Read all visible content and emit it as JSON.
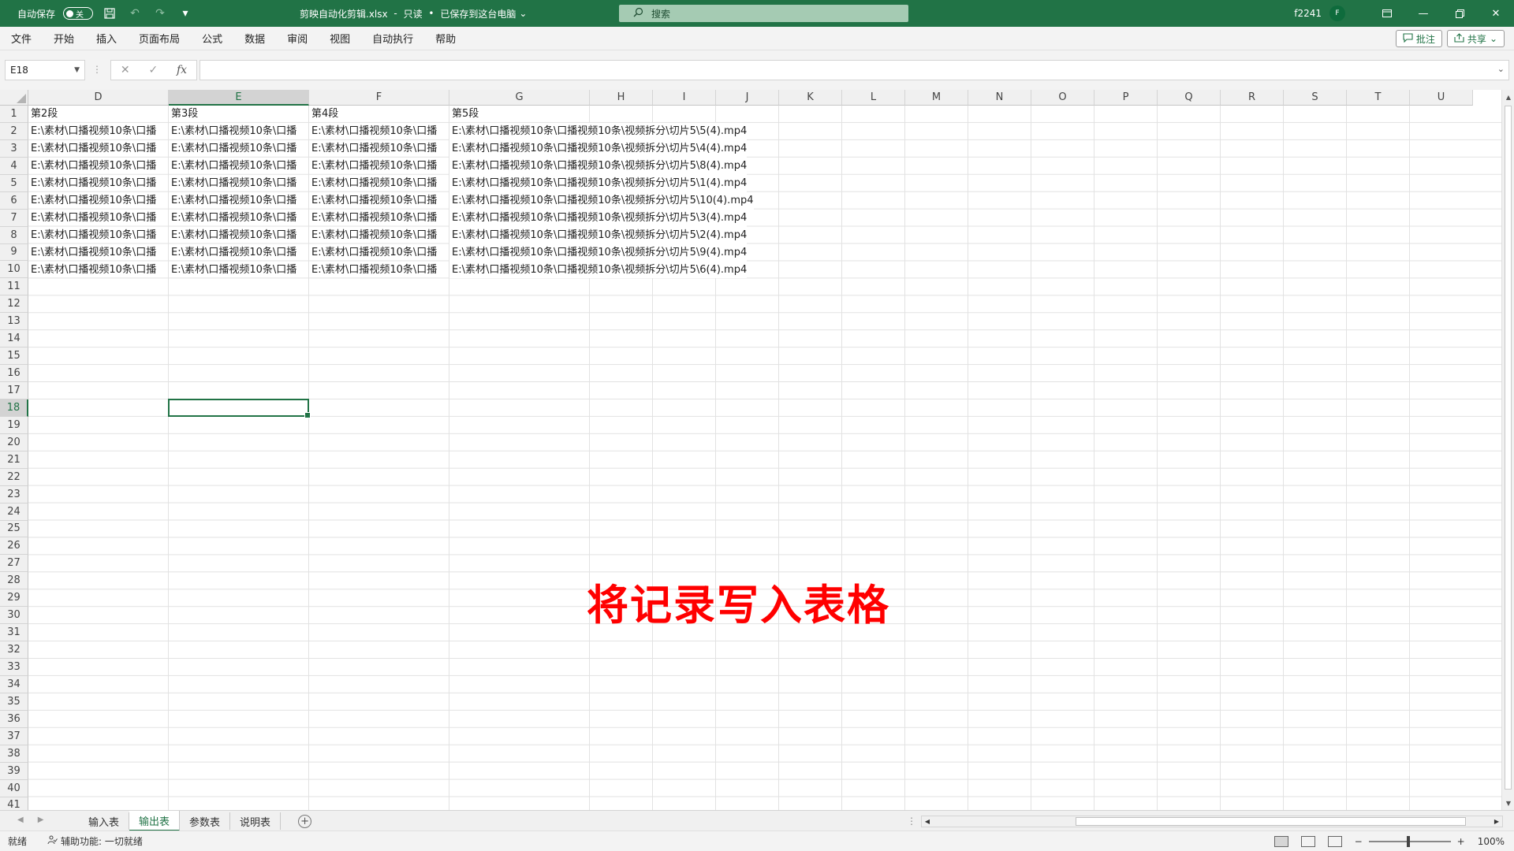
{
  "titlebar": {
    "autosave_label": "自动保存",
    "autosave_state": "关",
    "doc_title": "剪映自动化剪辑.xlsx",
    "doc_status": "只读",
    "save_status": "已保存到这台电脑",
    "search_placeholder": "搜索",
    "user_name": "f2241",
    "avatar_initial": "F"
  },
  "menu": {
    "items": [
      "文件",
      "开始",
      "插入",
      "页面布局",
      "公式",
      "数据",
      "审阅",
      "视图",
      "自动执行",
      "帮助"
    ],
    "comments_label": "批注",
    "share_label": "共享"
  },
  "formula_bar": {
    "name_box": "E18",
    "formula": ""
  },
  "grid": {
    "columns": [
      "D",
      "E",
      "F",
      "G",
      "H",
      "I",
      "J",
      "K",
      "L",
      "M",
      "N",
      "O",
      "P",
      "Q",
      "R",
      "S",
      "T",
      "U"
    ],
    "selected_column": "E",
    "selected_row": "18",
    "rows": [
      "1",
      "2",
      "3",
      "4",
      "5",
      "6",
      "7",
      "8",
      "9",
      "10",
      "11",
      "12",
      "13",
      "14",
      "15",
      "16",
      "17",
      "18",
      "19",
      "20",
      "21",
      "22",
      "23",
      "24",
      "25",
      "26",
      "27",
      "28",
      "29",
      "30",
      "31",
      "32",
      "33",
      "34",
      "35",
      "36",
      "37",
      "38",
      "39",
      "40",
      "41"
    ],
    "header_row": [
      "第2段",
      "第3段",
      "第4段",
      "第5段"
    ],
    "col_d_value": "E:\\素材\\口播视频10条\\口播",
    "col_e_value": "E:\\素材\\口播视频10条\\口播",
    "col_f_value": "E:\\素材\\口播视频10条\\口播",
    "col_g_values": [
      "E:\\素材\\口播视频10条\\口播视频10条\\视频拆分\\切片5\\5(4).mp4",
      "E:\\素材\\口播视频10条\\口播视频10条\\视频拆分\\切片5\\4(4).mp4",
      "E:\\素材\\口播视频10条\\口播视频10条\\视频拆分\\切片5\\8(4).mp4",
      "E:\\素材\\口播视频10条\\口播视频10条\\视频拆分\\切片5\\1(4).mp4",
      "E:\\素材\\口播视频10条\\口播视频10条\\视频拆分\\切片5\\10(4).mp4",
      "E:\\素材\\口播视频10条\\口播视频10条\\视频拆分\\切片5\\3(4).mp4",
      "E:\\素材\\口播视频10条\\口播视频10条\\视频拆分\\切片5\\2(4).mp4",
      "E:\\素材\\口播视频10条\\口播视频10条\\视频拆分\\切片5\\9(4).mp4",
      "E:\\素材\\口播视频10条\\口播视频10条\\视频拆分\\切片5\\6(4).mp4"
    ]
  },
  "overlay_caption": "将记录写入表格",
  "sheets": {
    "tabs": [
      "输入表",
      "输出表",
      "参数表",
      "说明表"
    ],
    "active": "输出表"
  },
  "status": {
    "ready": "就绪",
    "accessibility": "辅助功能: 一切就绪",
    "zoom": "100%"
  },
  "colors": {
    "brand": "#217346",
    "caption": "#ff0000"
  }
}
